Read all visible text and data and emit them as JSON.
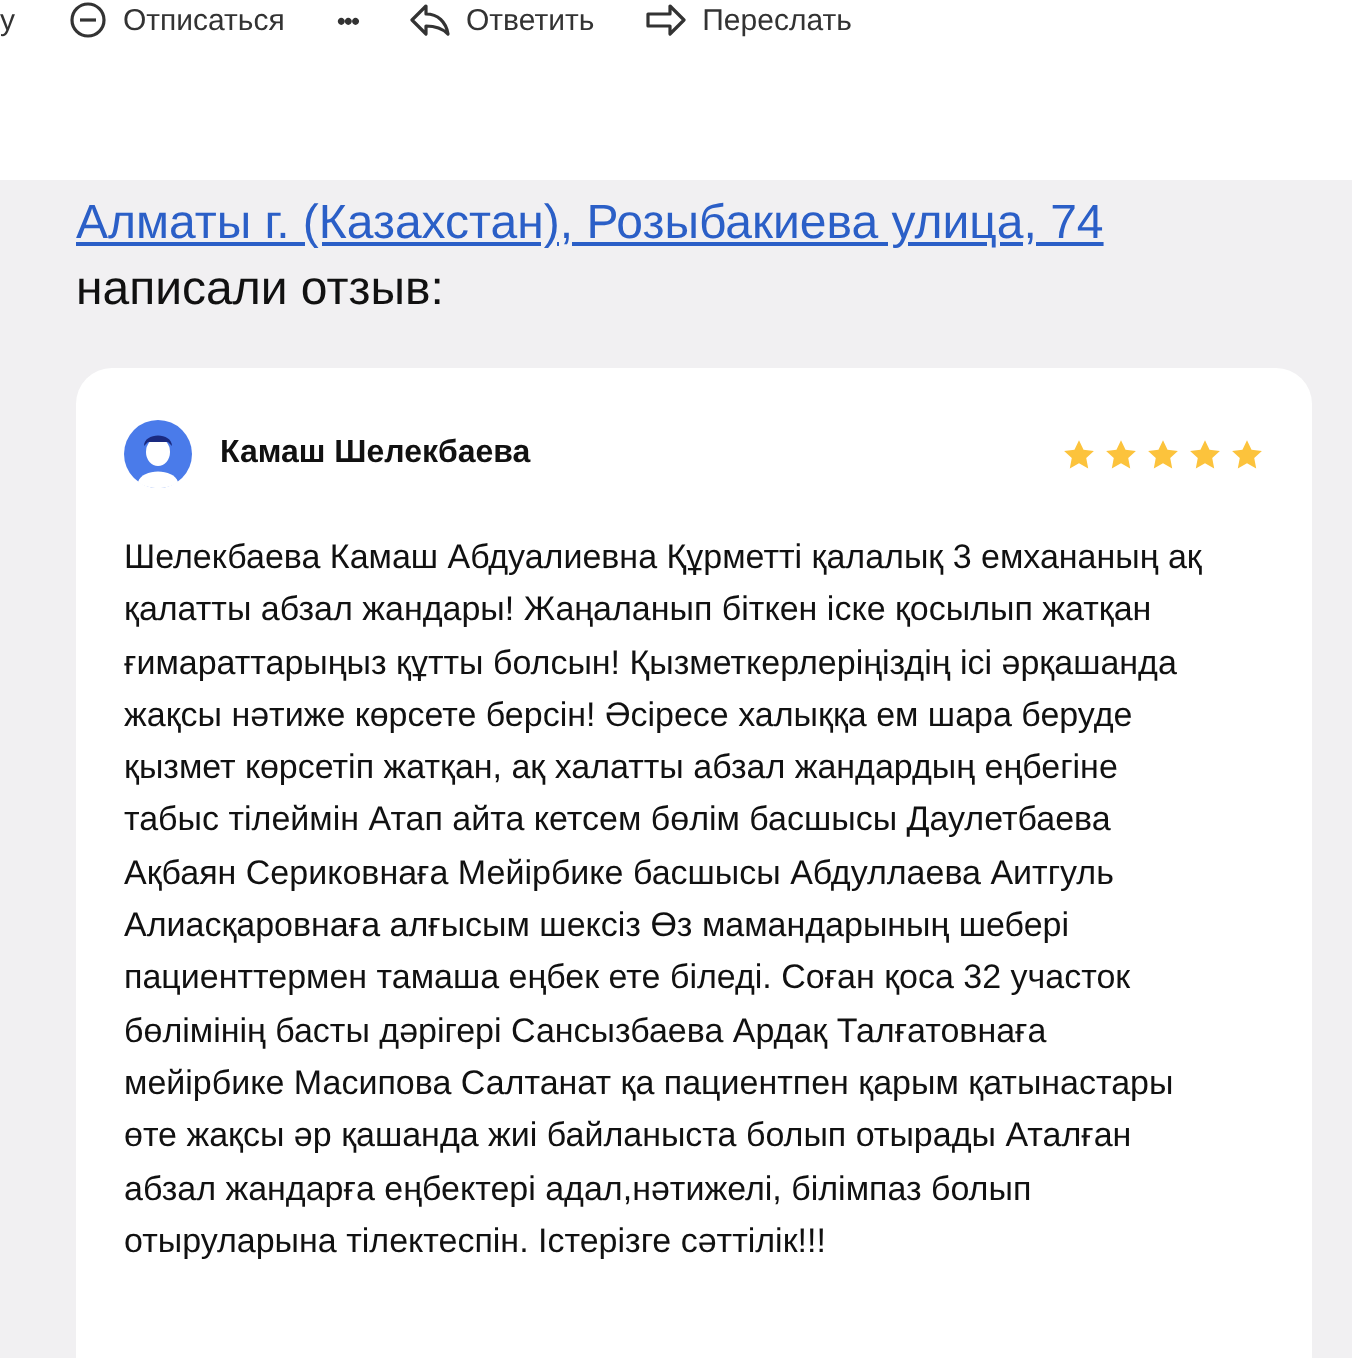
{
  "toolbar": {
    "items": [
      {
        "kind": "text",
        "label": "у"
      },
      {
        "kind": "unsubscribe",
        "label": "Отписаться"
      },
      {
        "kind": "more",
        "label": "•••"
      },
      {
        "kind": "reply",
        "label": "Ответить"
      },
      {
        "kind": "forward",
        "label": "Переслать"
      }
    ]
  },
  "message": {
    "address_link": "Алматы г. (Казахстан), Розыбакиева улица, 74",
    "caption": "написали отзыв:"
  },
  "review": {
    "author": "Камаш Шелекбаева",
    "stars": 5,
    "text": "Шелекбаева Камаш Абдуалиевна Құрметті қалалық 3 емхананың ақ қалатты абзал жандары! Жаңаланып біткен іске қосылып жатқан ғимараттарыңыз құтты болсын! Қызметкерлеріңіздің ісі әрқашанда жақсы нәтиже көрсете берсін! Әсіресе халыққа ем шара беруде қызмет көрсетіп жатқан, ақ халатты абзал жандардың еңбегіне табыс тілеймін Атап айта кетсем бөлім басшысы Даулетбаева Ақбаян Сериковнаға Мейірбике басшысы Абдуллаева Аитгуль Алиасқаровнаға алғысым шексіз Өз мамандарының шебері пациенттермен тамаша еңбек ете біледі. Соған қоса 32 участок бөлімінің басты дәрігері Сансызбаева Ардақ Талғатовнаға мейірбике Масипова Салтанат қа пациентпен қарым қатынастары өте жақсы әр қашанда жиі байланыста болып отырады Аталған абзал жандарға еңбектері адал,нәтижелі, білімпаз болып отыруларына тілектеспін. Істерізге сәттілік!!!"
  }
}
